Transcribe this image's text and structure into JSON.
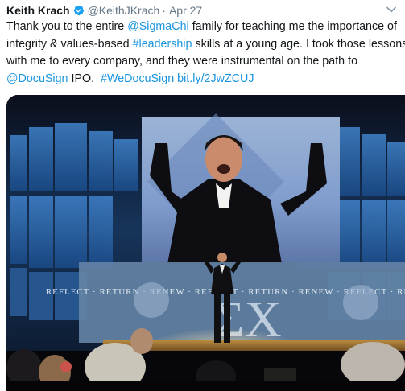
{
  "tweet": {
    "author_name": "Keith Krach",
    "handle": "@KeithJKrach",
    "separator": "·",
    "date": "Apr 27",
    "text": {
      "l1_a": "Thank you to the entire ",
      "l1_mention": "@SigmaChi",
      "l1_b": " family for teaching me the importance of",
      "l2_a": "integrity & values-based ",
      "l2_hashtag": "#leadership",
      "l2_b": " skills at a young age. I took those lessons",
      "l3": "with me to every company, and they were instrumental on the path to",
      "l4_mention": "@DocuSign",
      "l4_a": " IPO.  ",
      "l4_hashtag": "#WeDocuSign",
      "l4_sp": " ",
      "l4_url": "bit.ly/2JwZCUJ"
    },
    "media": {
      "backdrop_words": "REFLECT · RETURN · RENEW · REFLECT · RETURN · RENEW · REFLECT · RETURN",
      "emblem_letters": "ΣX"
    }
  },
  "colors": {
    "text": "#14171a",
    "muted": "#657786",
    "link": "#1b95e0",
    "verified": "#1da1f2"
  },
  "icons": {
    "verified": "verified-badge-icon",
    "menu": "chevron-down-icon"
  }
}
